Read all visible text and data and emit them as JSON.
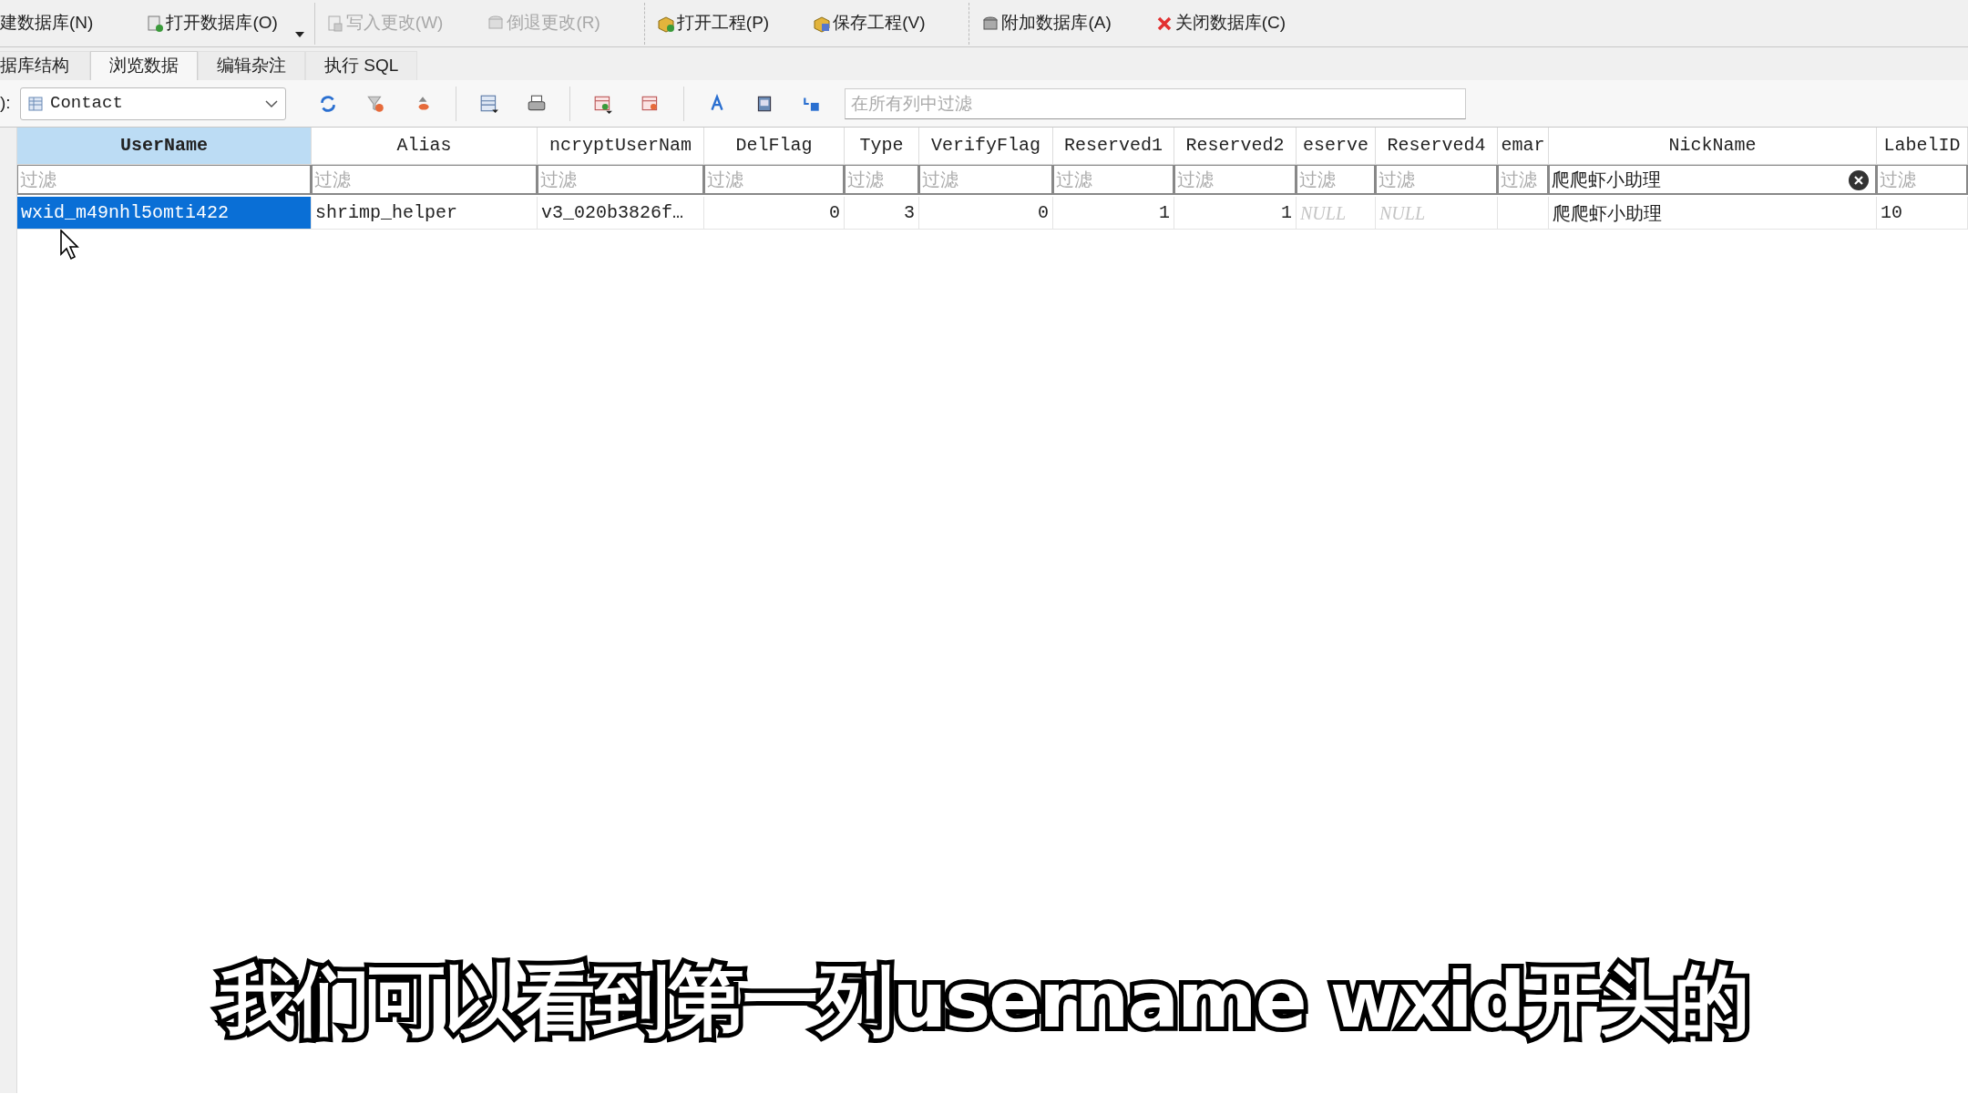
{
  "main_toolbar": [
    {
      "kind": "new",
      "label": "建数据库(N)",
      "disabled": false
    },
    {
      "kind": "open",
      "label": "打开数据库(O)",
      "disabled": false
    },
    {
      "kind": "write",
      "label": "写入更改(W)",
      "disabled": true
    },
    {
      "kind": "revert",
      "label": "倒退更改(R)",
      "disabled": true
    },
    {
      "kind": "project-open",
      "label": "打开工程(P)",
      "disabled": false
    },
    {
      "kind": "project-save",
      "label": "保存工程(V)",
      "disabled": false
    },
    {
      "kind": "attach",
      "label": "附加数据库(A)",
      "disabled": false
    },
    {
      "kind": "close",
      "label": "关闭数据库(C)",
      "disabled": false
    }
  ],
  "tabs": [
    {
      "label": "据库结构",
      "selected": false
    },
    {
      "label": "浏览数据",
      "selected": true
    },
    {
      "label": "编辑杂注",
      "selected": false
    },
    {
      "label": "执行 SQL",
      "selected": false
    }
  ],
  "browse_toolbar": {
    "table_label": "):",
    "table_select": "Contact",
    "filter_placeholder": "在所有列中过滤"
  },
  "table": {
    "columns": [
      {
        "label": "UserName",
        "selected": true,
        "filter": {
          "placeholder": "过滤"
        }
      },
      {
        "label": "Alias",
        "selected": false,
        "filter": {
          "placeholder": "过滤"
        }
      },
      {
        "label": "ncryptUserNam",
        "selected": false,
        "filter": {
          "placeholder": "过滤"
        }
      },
      {
        "label": "DelFlag",
        "selected": false,
        "filter": {
          "placeholder": "过滤"
        }
      },
      {
        "label": "Type",
        "selected": false,
        "filter": {
          "placeholder": "过滤"
        }
      },
      {
        "label": "VerifyFlag",
        "selected": false,
        "filter": {
          "placeholder": "过滤"
        }
      },
      {
        "label": "Reserved1",
        "selected": false,
        "filter": {
          "placeholder": "过滤"
        }
      },
      {
        "label": "Reserved2",
        "selected": false,
        "filter": {
          "placeholder": "过滤"
        }
      },
      {
        "label": "eserve",
        "selected": false,
        "filter": {
          "placeholder": "过滤"
        }
      },
      {
        "label": "Reserved4",
        "selected": false,
        "filter": {
          "placeholder": "过滤"
        }
      },
      {
        "label": "emar",
        "selected": false,
        "filter": {
          "placeholder": "过滤"
        }
      },
      {
        "label": "NickName",
        "selected": false,
        "filter": {
          "value": "爬爬虾小助理"
        }
      },
      {
        "label": "LabelID",
        "selected": false,
        "filter": {
          "placeholder": "过滤"
        }
      }
    ],
    "rows": [
      {
        "cells": [
          {
            "text": "wxid_m49nhl5omti422",
            "kind": "text",
            "selected": true
          },
          {
            "text": "shrimp_helper",
            "kind": "text",
            "selected": false
          },
          {
            "text": "v3_020b3826f…",
            "kind": "text",
            "selected": false
          },
          {
            "text": "0",
            "kind": "number",
            "selected": false
          },
          {
            "text": "3",
            "kind": "number",
            "selected": false
          },
          {
            "text": "0",
            "kind": "number",
            "selected": false
          },
          {
            "text": "1",
            "kind": "number",
            "selected": false
          },
          {
            "text": "1",
            "kind": "number",
            "selected": false
          },
          {
            "text": "NULL",
            "kind": "null",
            "selected": false
          },
          {
            "text": "NULL",
            "kind": "null",
            "selected": false
          },
          {
            "kind": "empty",
            "selected": false
          },
          {
            "text": "爬爬虾小助理",
            "kind": "text",
            "selected": false
          },
          {
            "text": "10",
            "kind": "text",
            "selected": false
          }
        ]
      }
    ]
  },
  "subtitle": "我们可以看到第一列username wxid开头的"
}
